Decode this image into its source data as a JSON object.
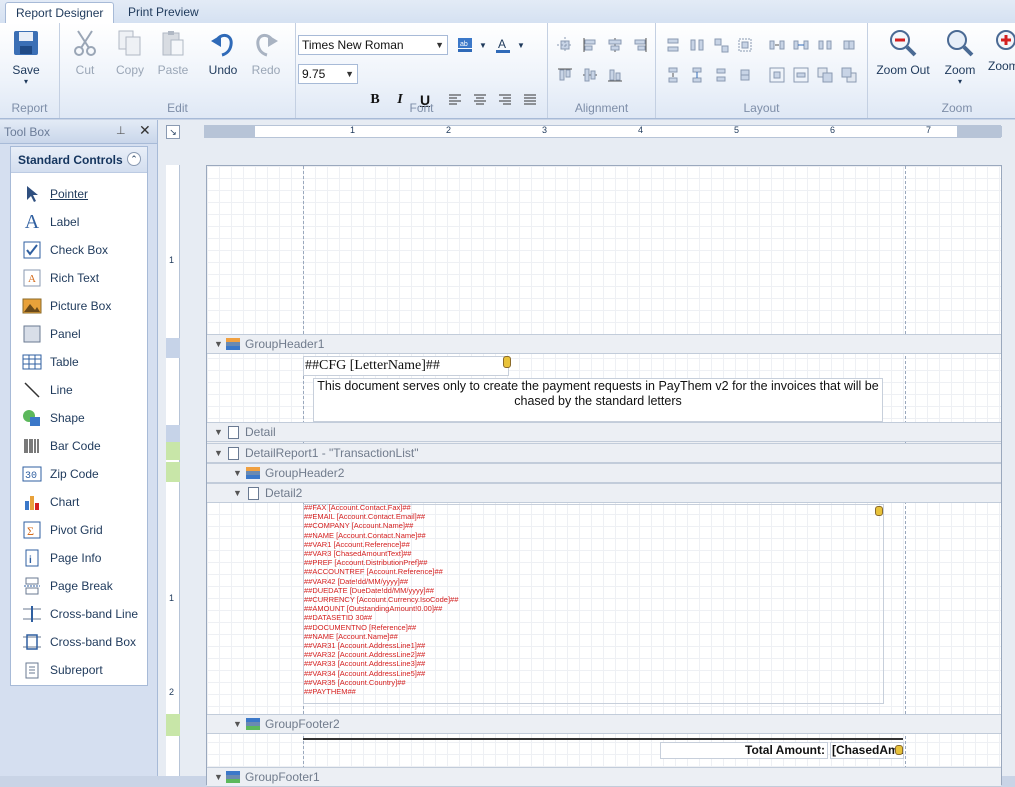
{
  "tabs": [
    {
      "label": "Report Designer",
      "active": true
    },
    {
      "label": "Print Preview",
      "active": false
    }
  ],
  "ribbon": {
    "report": {
      "label": "Report",
      "save": "Save"
    },
    "edit": {
      "label": "Edit",
      "cut": "Cut",
      "copy": "Copy",
      "paste": "Paste",
      "undo": "Undo",
      "redo": "Redo"
    },
    "font": {
      "label": "Font",
      "family": "Times New Roman",
      "size": "9.75",
      "bold": "B",
      "italic": "I",
      "underline": "U"
    },
    "alignment": {
      "label": "Alignment"
    },
    "layout": {
      "label": "Layout"
    },
    "zoom": {
      "label": "Zoom",
      "zoom_out": "Zoom Out",
      "zoom": "Zoom",
      "zoom_in": "Zoom In"
    }
  },
  "toolbox": {
    "title": "Tool Box",
    "category": "Standard Controls",
    "items": [
      "Pointer",
      "Label",
      "Check Box",
      "Rich Text",
      "Picture Box",
      "Panel",
      "Table",
      "Line",
      "Shape",
      "Bar Code",
      "Zip Code",
      "Chart",
      "Pivot Grid",
      "Page Info",
      "Page Break",
      "Cross-band Line",
      "Cross-band Box",
      "Subreport"
    ]
  },
  "report": {
    "bands": {
      "group_header1": "GroupHeader1",
      "detail": "Detail",
      "detail_report": "DetailReport1 - \"TransactionList\"",
      "group_header2": "GroupHeader2",
      "detail2": "Detail2",
      "group_footer2": "GroupFooter2",
      "group_footer1": "GroupFooter1"
    },
    "letter_name": "##CFG [LetterName]##",
    "description": "This document serves only to create the payment requests in PayThem v2 for the invoices that will be chased by the standard letters",
    "fields": [
      "##FAX [Account.Contact.Fax]##",
      "##EMAIL [Account.Contact.Email]##",
      "##COMPANY [Account.Name]##",
      "##NAME [Account.Contact.Name]##",
      "##VAR1 [Account.Reference]##",
      "##VAR3 [ChasedAmountText]##",
      "##PREF [Account.DistributionPref]##",
      "##ACCOUNTREF [Account.Reference]##",
      "##VAR42 [Date!dd/MM/yyyy]##",
      "##DUEDATE [DueDate!dd/MM/yyyy]##",
      "##CURRENCY [Account.Currency.IsoCode]##",
      "##AMOUNT [OutstandingAmount!0.00]##",
      "##DATASETID 30##",
      "##DOCUMENTNO [Reference]##",
      "##NAME [Account.Name]##",
      "##VAR31 [Account.AddressLine1]##",
      "##VAR32 [Account.AddressLine2]##",
      "##VAR33 [Account.AddressLine3]##",
      "##VAR34 [Account.AddressLine5]##",
      "##VAR35 [Account.Country]##",
      "##PAYTHEM##"
    ],
    "total_label": "Total Amount:",
    "total_value": "[ChasedAmo"
  },
  "ruler": {
    "labels": [
      "1",
      "2",
      "3",
      "4",
      "5",
      "6",
      "7"
    ],
    "vlabels": [
      "1",
      "1",
      "2"
    ]
  }
}
